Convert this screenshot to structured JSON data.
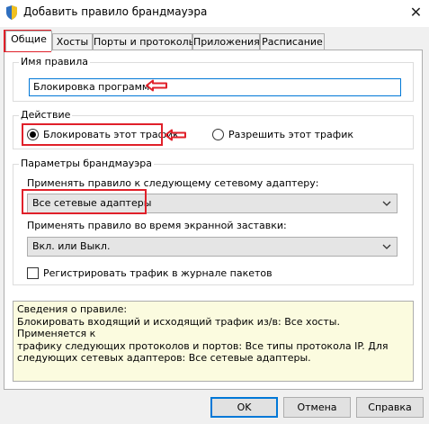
{
  "window": {
    "title": "Добавить правило брандмауэра",
    "close_glyph": "✕"
  },
  "tabs": [
    {
      "label": "Общие",
      "active": true
    },
    {
      "label": "Хосты",
      "active": false
    },
    {
      "label": "Порты и протоколы",
      "active": false
    },
    {
      "label": "Приложения",
      "active": false
    },
    {
      "label": "Расписание",
      "active": false
    }
  ],
  "rule_name": {
    "legend": "Имя правила",
    "value": "Блокировка программ"
  },
  "action": {
    "legend": "Действие",
    "options": [
      {
        "label": "Блокировать этот трафик",
        "checked": true
      },
      {
        "label": "Разрешить этот трафик",
        "checked": false
      }
    ]
  },
  "firewall_params": {
    "legend": "Параметры брандмауэра",
    "adapter_label": "Применять правило к следующему сетевому адаптеру:",
    "adapter_value": "Все сетевые адаптеры",
    "screensaver_label": "Применять правило во время экранной заставки:",
    "screensaver_value": "Вкл. или Выкл.",
    "log_label": "Регистрировать трафик в журнале пакетов",
    "log_checked": false
  },
  "info": {
    "lines": [
      "Сведения о правиле:",
      "Блокировать входящий и исходящий трафик из/в: Все хосты. Применяется к",
      "трафику следующих протоколов и портов:  Все типы протокола IP. Для",
      "следующих сетевых адаптеров: Все сетевые адаптеры."
    ]
  },
  "buttons": {
    "ok": "OK",
    "cancel": "Отмена",
    "help": "Справка"
  },
  "colors": {
    "annotation": "#e0202a",
    "accent": "#0078d7",
    "info_bg": "#fbfbdf"
  }
}
